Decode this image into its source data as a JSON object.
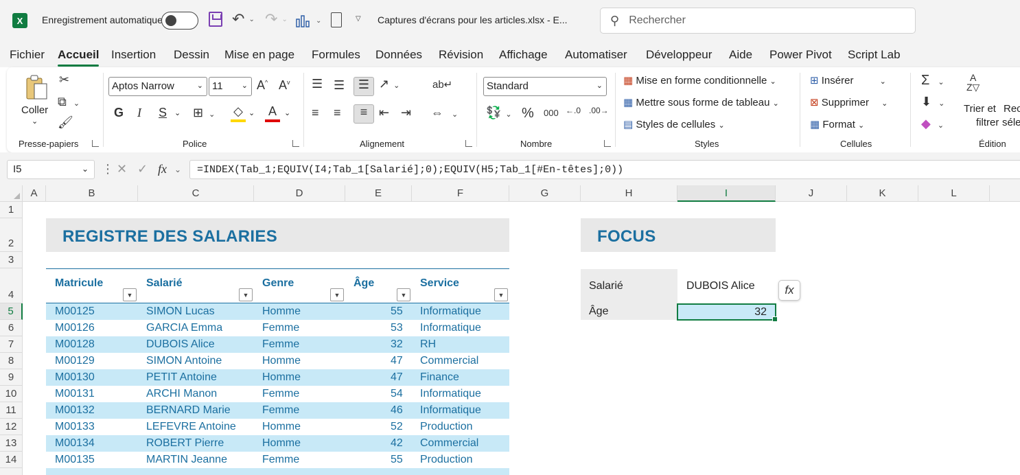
{
  "titlebar": {
    "autosave_label": "Enregistrement automatique",
    "document_title": "Captures d'écrans pour les articles.xlsx  -  E...",
    "search_placeholder": "Rechercher",
    "app_icon": "excel-logo"
  },
  "menu": {
    "tabs": [
      "Fichier",
      "Accueil",
      "Insertion",
      "Dessin",
      "Mise en page",
      "Formules",
      "Données",
      "Révision",
      "Affichage",
      "Automatiser",
      "Développeur",
      "Aide",
      "Power Pivot",
      "Script Lab"
    ],
    "active": "Accueil"
  },
  "ribbon": {
    "clipboard": {
      "paste_label": "Coller",
      "group_label": "Presse-papiers"
    },
    "font": {
      "font_name": "Aptos Narrow",
      "font_size": "11",
      "bold": "G",
      "italic": "I",
      "underline": "S",
      "group_label": "Police"
    },
    "alignment": {
      "group_label": "Alignement"
    },
    "number": {
      "format": "Standard",
      "percent": "%",
      "thousands": "000",
      "group_label": "Nombre"
    },
    "styles": {
      "conditional": "Mise en forme conditionnelle",
      "as_table": "Mettre sous forme de tableau",
      "cell_styles": "Styles de cellules",
      "group_label": "Styles"
    },
    "cells": {
      "insert": "Insérer",
      "delete": "Supprimer",
      "format": "Format",
      "group_label": "Cellules"
    },
    "editing": {
      "sort_filter_1": "Trier et",
      "sort_filter_2": "filtrer",
      "find_1": "Rec",
      "find_2": "séle",
      "group_label": "Édition"
    }
  },
  "formula_bar": {
    "name_box": "I5",
    "fx": "fx",
    "formula": "=INDEX(Tab_1;EQUIV(I4;Tab_1[Salarié];0);EQUIV(H5;Tab_1[#En-têtes];0))"
  },
  "columns": [
    "A",
    "B",
    "C",
    "D",
    "E",
    "F",
    "G",
    "H",
    "I",
    "J",
    "K",
    "L"
  ],
  "rows": [
    "1",
    "2",
    "3",
    "4",
    "5",
    "6",
    "7",
    "8",
    "9",
    "10",
    "11",
    "12",
    "13",
    "14"
  ],
  "sheet": {
    "title": "REGISTRE DES SALARIES",
    "headers": [
      "Matricule",
      "Salarié",
      "Genre",
      "Âge",
      "Service"
    ],
    "data": [
      [
        "M00125",
        "SIMON Lucas",
        "Homme",
        "55",
        "Informatique"
      ],
      [
        "M00126",
        "GARCIA Emma",
        "Femme",
        "53",
        "Informatique"
      ],
      [
        "M00128",
        "DUBOIS Alice",
        "Femme",
        "32",
        "RH"
      ],
      [
        "M00129",
        "SIMON Antoine",
        "Homme",
        "47",
        "Commercial"
      ],
      [
        "M00130",
        "PETIT Antoine",
        "Homme",
        "47",
        "Finance"
      ],
      [
        "M00131",
        "ARCHI Manon",
        "Femme",
        "54",
        "Informatique"
      ],
      [
        "M00132",
        "BERNARD Marie",
        "Femme",
        "46",
        "Informatique"
      ],
      [
        "M00133",
        "LEFEVRE Antoine",
        "Homme",
        "52",
        "Production"
      ],
      [
        "M00134",
        "ROBERT Pierre",
        "Homme",
        "42",
        "Commercial"
      ],
      [
        "M00135",
        "MARTIN Jeanne",
        "Femme",
        "55",
        "Production"
      ]
    ]
  },
  "focus": {
    "title": "FOCUS",
    "label_salarie": "Salarié",
    "value_salarie": "DUBOIS Alice",
    "label_age": "Âge",
    "value_age": "32"
  },
  "colors": {
    "accent_green": "#107c41",
    "table_blue": "#1b6fa0",
    "band_blue": "#c8e9f7"
  }
}
